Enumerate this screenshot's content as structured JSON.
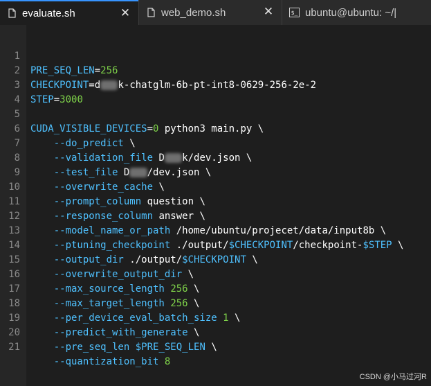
{
  "tabs": [
    {
      "label": "evaluate.sh",
      "icon": "file-icon",
      "active": true
    },
    {
      "label": "web_demo.sh",
      "icon": "file-icon",
      "active": false
    },
    {
      "label": "ubuntu@ubuntu: ~/|",
      "icon": "terminal-icon",
      "active": false
    }
  ],
  "code": {
    "line_numbers": [
      "1",
      "2",
      "3",
      "4",
      "5",
      "6",
      "7",
      "8",
      "9",
      "10",
      "11",
      "12",
      "13",
      "14",
      "15",
      "16",
      "17",
      "18",
      "19",
      "20",
      "21"
    ],
    "l1": {
      "var": "PRE_SEQ_LEN",
      "eq": "=",
      "val": "256"
    },
    "l2": {
      "var": "CHECKPOINT",
      "eq": "=",
      "pre": "d",
      "redacted": "xxx",
      "post": "k-chatglm-6b-pt-int8-0629-256-2e-2"
    },
    "l3": {
      "var": "STEP",
      "eq": "=",
      "val": "3000"
    },
    "l5": {
      "var": "CUDA_VISIBLE_DEVICES",
      "eq": "=",
      "val": "0",
      "rest": " python3 main.py \\"
    },
    "l6": {
      "flag": "--do_predict",
      "rest": " \\"
    },
    "l7": {
      "flag": "--validation_file",
      "pre": " D",
      "redacted": "xxx",
      "post": "k/dev.json \\"
    },
    "l8": {
      "flag": "--test_file",
      "pre": " D",
      "redacted": "xxx",
      "post": "/dev.json \\"
    },
    "l9": {
      "flag": "--overwrite_cache",
      "rest": " \\"
    },
    "l10": {
      "flag": "--prompt_column",
      "rest": " question \\"
    },
    "l11": {
      "flag": "--response_column",
      "rest": " answer \\"
    },
    "l12": {
      "flag": "--model_name_or_path",
      "rest": " /home/ubuntu/projecet/data/input8b \\"
    },
    "l13": {
      "flag": "--ptuning_checkpoint",
      "p1": " ./output/",
      "v1": "$CHECKPOINT",
      "p2": "/checkpoint-",
      "v2": "$STEP",
      "p3": " \\"
    },
    "l14": {
      "flag": "--output_dir",
      "p1": " ./output/",
      "v1": "$CHECKPOINT",
      "p3": " \\"
    },
    "l15": {
      "flag": "--overwrite_output_dir",
      "rest": " \\"
    },
    "l16": {
      "flag": "--max_source_length",
      "num": "256",
      "rest": " \\"
    },
    "l17": {
      "flag": "--max_target_length",
      "num": "256",
      "rest": " \\"
    },
    "l18": {
      "flag": "--per_device_eval_batch_size",
      "num": "1",
      "rest": " \\"
    },
    "l19": {
      "flag": "--predict_with_generate",
      "rest": " \\"
    },
    "l20": {
      "flag": "--pre_seq_len",
      "v1": "$PRE_SEQ_LEN",
      "rest": " \\"
    },
    "l21": {
      "flag": "--quantization_bit",
      "num": "8"
    }
  },
  "watermark": "CSDN @小马过河R",
  "colors": {
    "variable": "#4fc1ff",
    "number": "#7fd34a",
    "text": "#ffffff",
    "accent": "#3794ff"
  }
}
